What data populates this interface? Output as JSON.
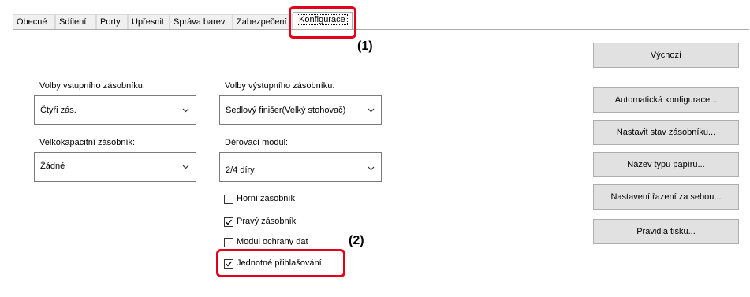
{
  "tabs": [
    "Obecné",
    "Sdílení",
    "Porty",
    "Upřesnit",
    "Správa barev",
    "Zabezpečení",
    "Konfigurace"
  ],
  "callouts": {
    "one": "(1)",
    "two": "(2)"
  },
  "input_tray": {
    "label": "Volby vstupního zásobníku:",
    "value": "Čtyři zás."
  },
  "output_tray": {
    "label": "Volby výstupního zásobníku:",
    "value": "Sedlový finišer(Velký stohovač)"
  },
  "lcc": {
    "label": "Velkokapacitní zásobník:",
    "value": "Žádné"
  },
  "punch": {
    "label": "Děrovací modul:",
    "value": "2/4 díry"
  },
  "checkboxes": [
    {
      "label": "Horní zásobník",
      "checked": false
    },
    {
      "label": "Pravý zásobník",
      "checked": true
    },
    {
      "label": "Modul ochrany dat",
      "checked": false
    },
    {
      "label": "Jednotné přihlašování",
      "checked": true
    }
  ],
  "buttons": {
    "default": "Výchozí",
    "auto_config": "Automatická konfigurace...",
    "tray_status": "Nastavit stav zásobníku...",
    "paper_type": "Název typu papíru...",
    "sequence": "Nastavení řazení za sebou...",
    "print_rules": "Pravidla tisku..."
  },
  "colors": {
    "highlight": "#e3001b"
  }
}
